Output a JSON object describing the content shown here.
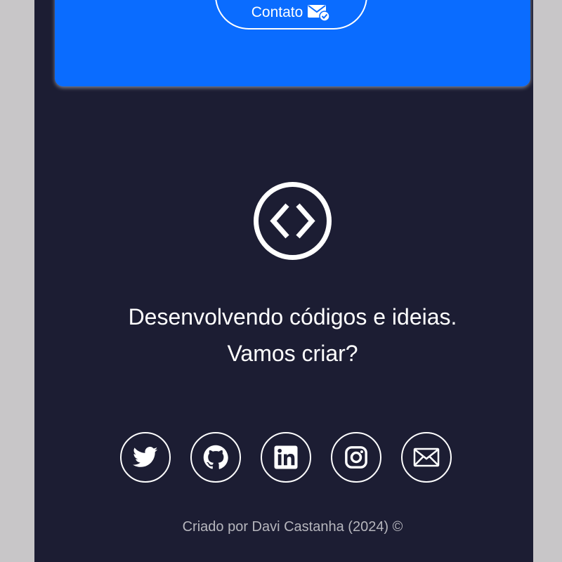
{
  "contact": {
    "label": "Contato",
    "icon": "mail-check-icon"
  },
  "logo": {
    "icon": "code-brackets-icon"
  },
  "tagline": {
    "line1": "Desenvolvendo códigos e ideias.",
    "line2": "Vamos criar?"
  },
  "socials": [
    {
      "name": "twitter",
      "icon": "twitter-icon"
    },
    {
      "name": "github",
      "icon": "github-icon"
    },
    {
      "name": "linkedin",
      "icon": "linkedin-icon"
    },
    {
      "name": "instagram",
      "icon": "instagram-icon"
    },
    {
      "name": "email",
      "icon": "mail-icon"
    }
  ],
  "footer": {
    "credit": "Criado por Davi Castanha (2024) ©"
  },
  "colors": {
    "page_background": "#1c1d33",
    "accent": "#0a6cff",
    "outer_background": "#c8c6c8"
  }
}
